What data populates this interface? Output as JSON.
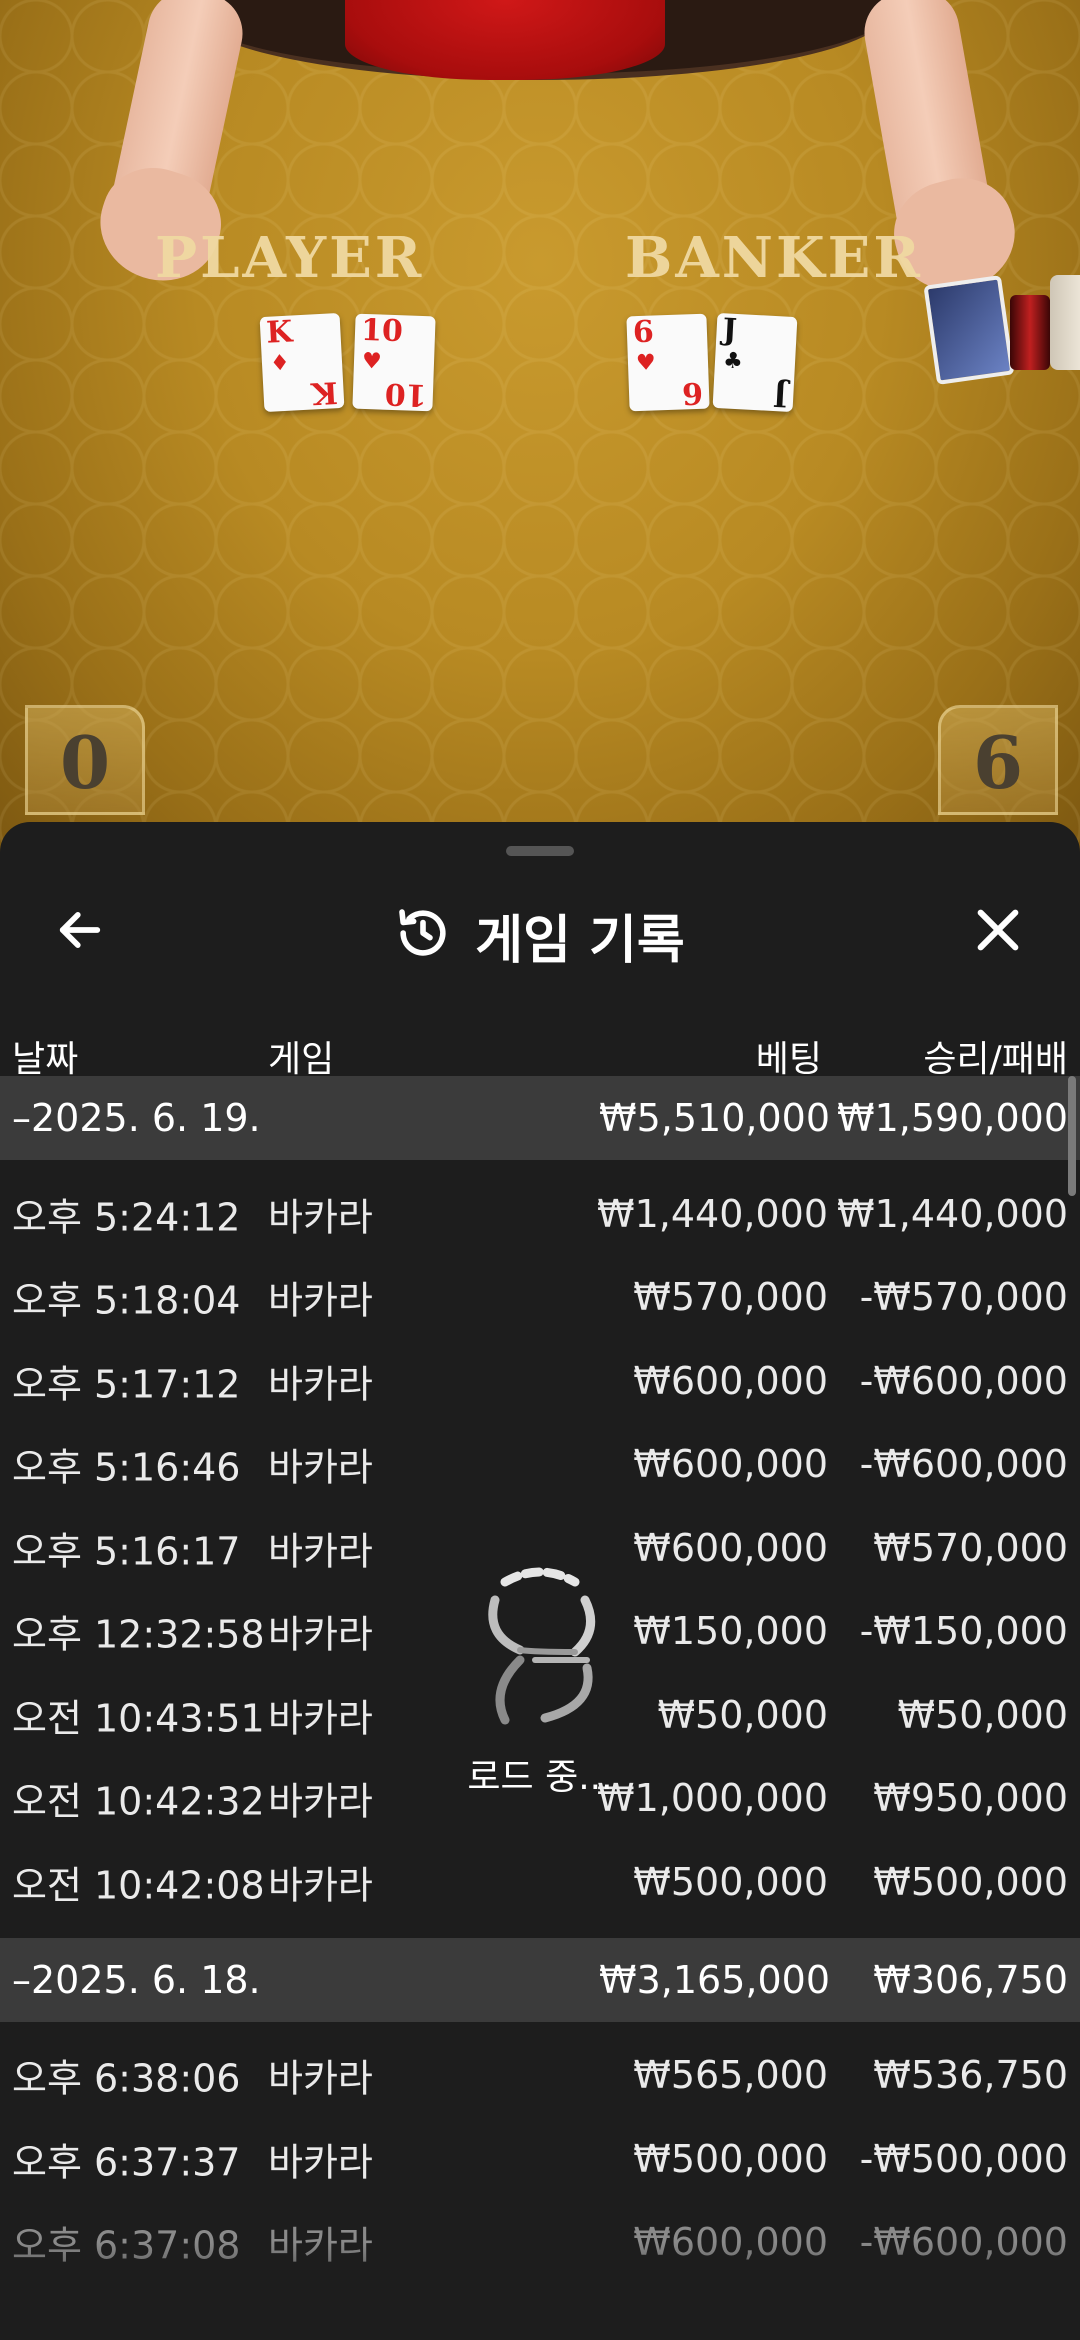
{
  "video": {
    "player_label": "PLAYER",
    "banker_label": "BANKER",
    "player_cards": [
      {
        "rank": "K",
        "suit": "♦",
        "color": "red"
      },
      {
        "rank": "10",
        "suit": "♥",
        "color": "red"
      }
    ],
    "banker_cards": [
      {
        "rank": "6",
        "suit": "♥",
        "color": "red"
      },
      {
        "rank": "J",
        "suit": "♣",
        "color": "black"
      }
    ],
    "player_score": "0",
    "banker_score": "6"
  },
  "sheet": {
    "title": "게임 기록",
    "icons": {
      "back": "arrow-left-icon",
      "history": "history-icon",
      "close": "close-icon"
    },
    "columns": {
      "date": "날짜",
      "game": "게임",
      "bet": "베팅",
      "win_loss": "승리/패배"
    },
    "groups": [
      {
        "date": "–2025. 6. 19.",
        "total_bet": "₩5,510,000",
        "total_win": "₩1,590,000",
        "rows": [
          {
            "time": "오후 5:24:12",
            "game": "바카라",
            "bet": "₩1,440,000",
            "win": "₩1,440,000"
          },
          {
            "time": "오후 5:18:04",
            "game": "바카라",
            "bet": "₩570,000",
            "win": "-₩570,000"
          },
          {
            "time": "오후 5:17:12",
            "game": "바카라",
            "bet": "₩600,000",
            "win": "-₩600,000"
          },
          {
            "time": "오후 5:16:46",
            "game": "바카라",
            "bet": "₩600,000",
            "win": "-₩600,000"
          },
          {
            "time": "오후 5:16:17",
            "game": "바카라",
            "bet": "₩600,000",
            "win": "₩570,000"
          },
          {
            "time": "오후 12:32:58",
            "game": "바카라",
            "bet": "₩150,000",
            "win": "-₩150,000"
          },
          {
            "time": "오전 10:43:51",
            "game": "바카라",
            "bet": "₩50,000",
            "win": "₩50,000"
          },
          {
            "time": "오전 10:42:32",
            "game": "바카라",
            "bet": "₩1,000,000",
            "win": "₩950,000"
          },
          {
            "time": "오전 10:42:08",
            "game": "바카라",
            "bet": "₩500,000",
            "win": "₩500,000"
          }
        ]
      },
      {
        "date": "–2025. 6. 18.",
        "total_bet": "₩3,165,000",
        "total_win": "₩306,750",
        "rows": [
          {
            "time": "오후 6:38:06",
            "game": "바카라",
            "bet": "₩565,000",
            "win": "₩536,750"
          },
          {
            "time": "오후 6:37:37",
            "game": "바카라",
            "bet": "₩500,000",
            "win": "-₩500,000"
          },
          {
            "time": "오후 6:37:08",
            "game": "바카라",
            "bet": "₩600,000",
            "win": "-₩600,000"
          }
        ]
      }
    ],
    "loading_text": "로드 중..."
  }
}
